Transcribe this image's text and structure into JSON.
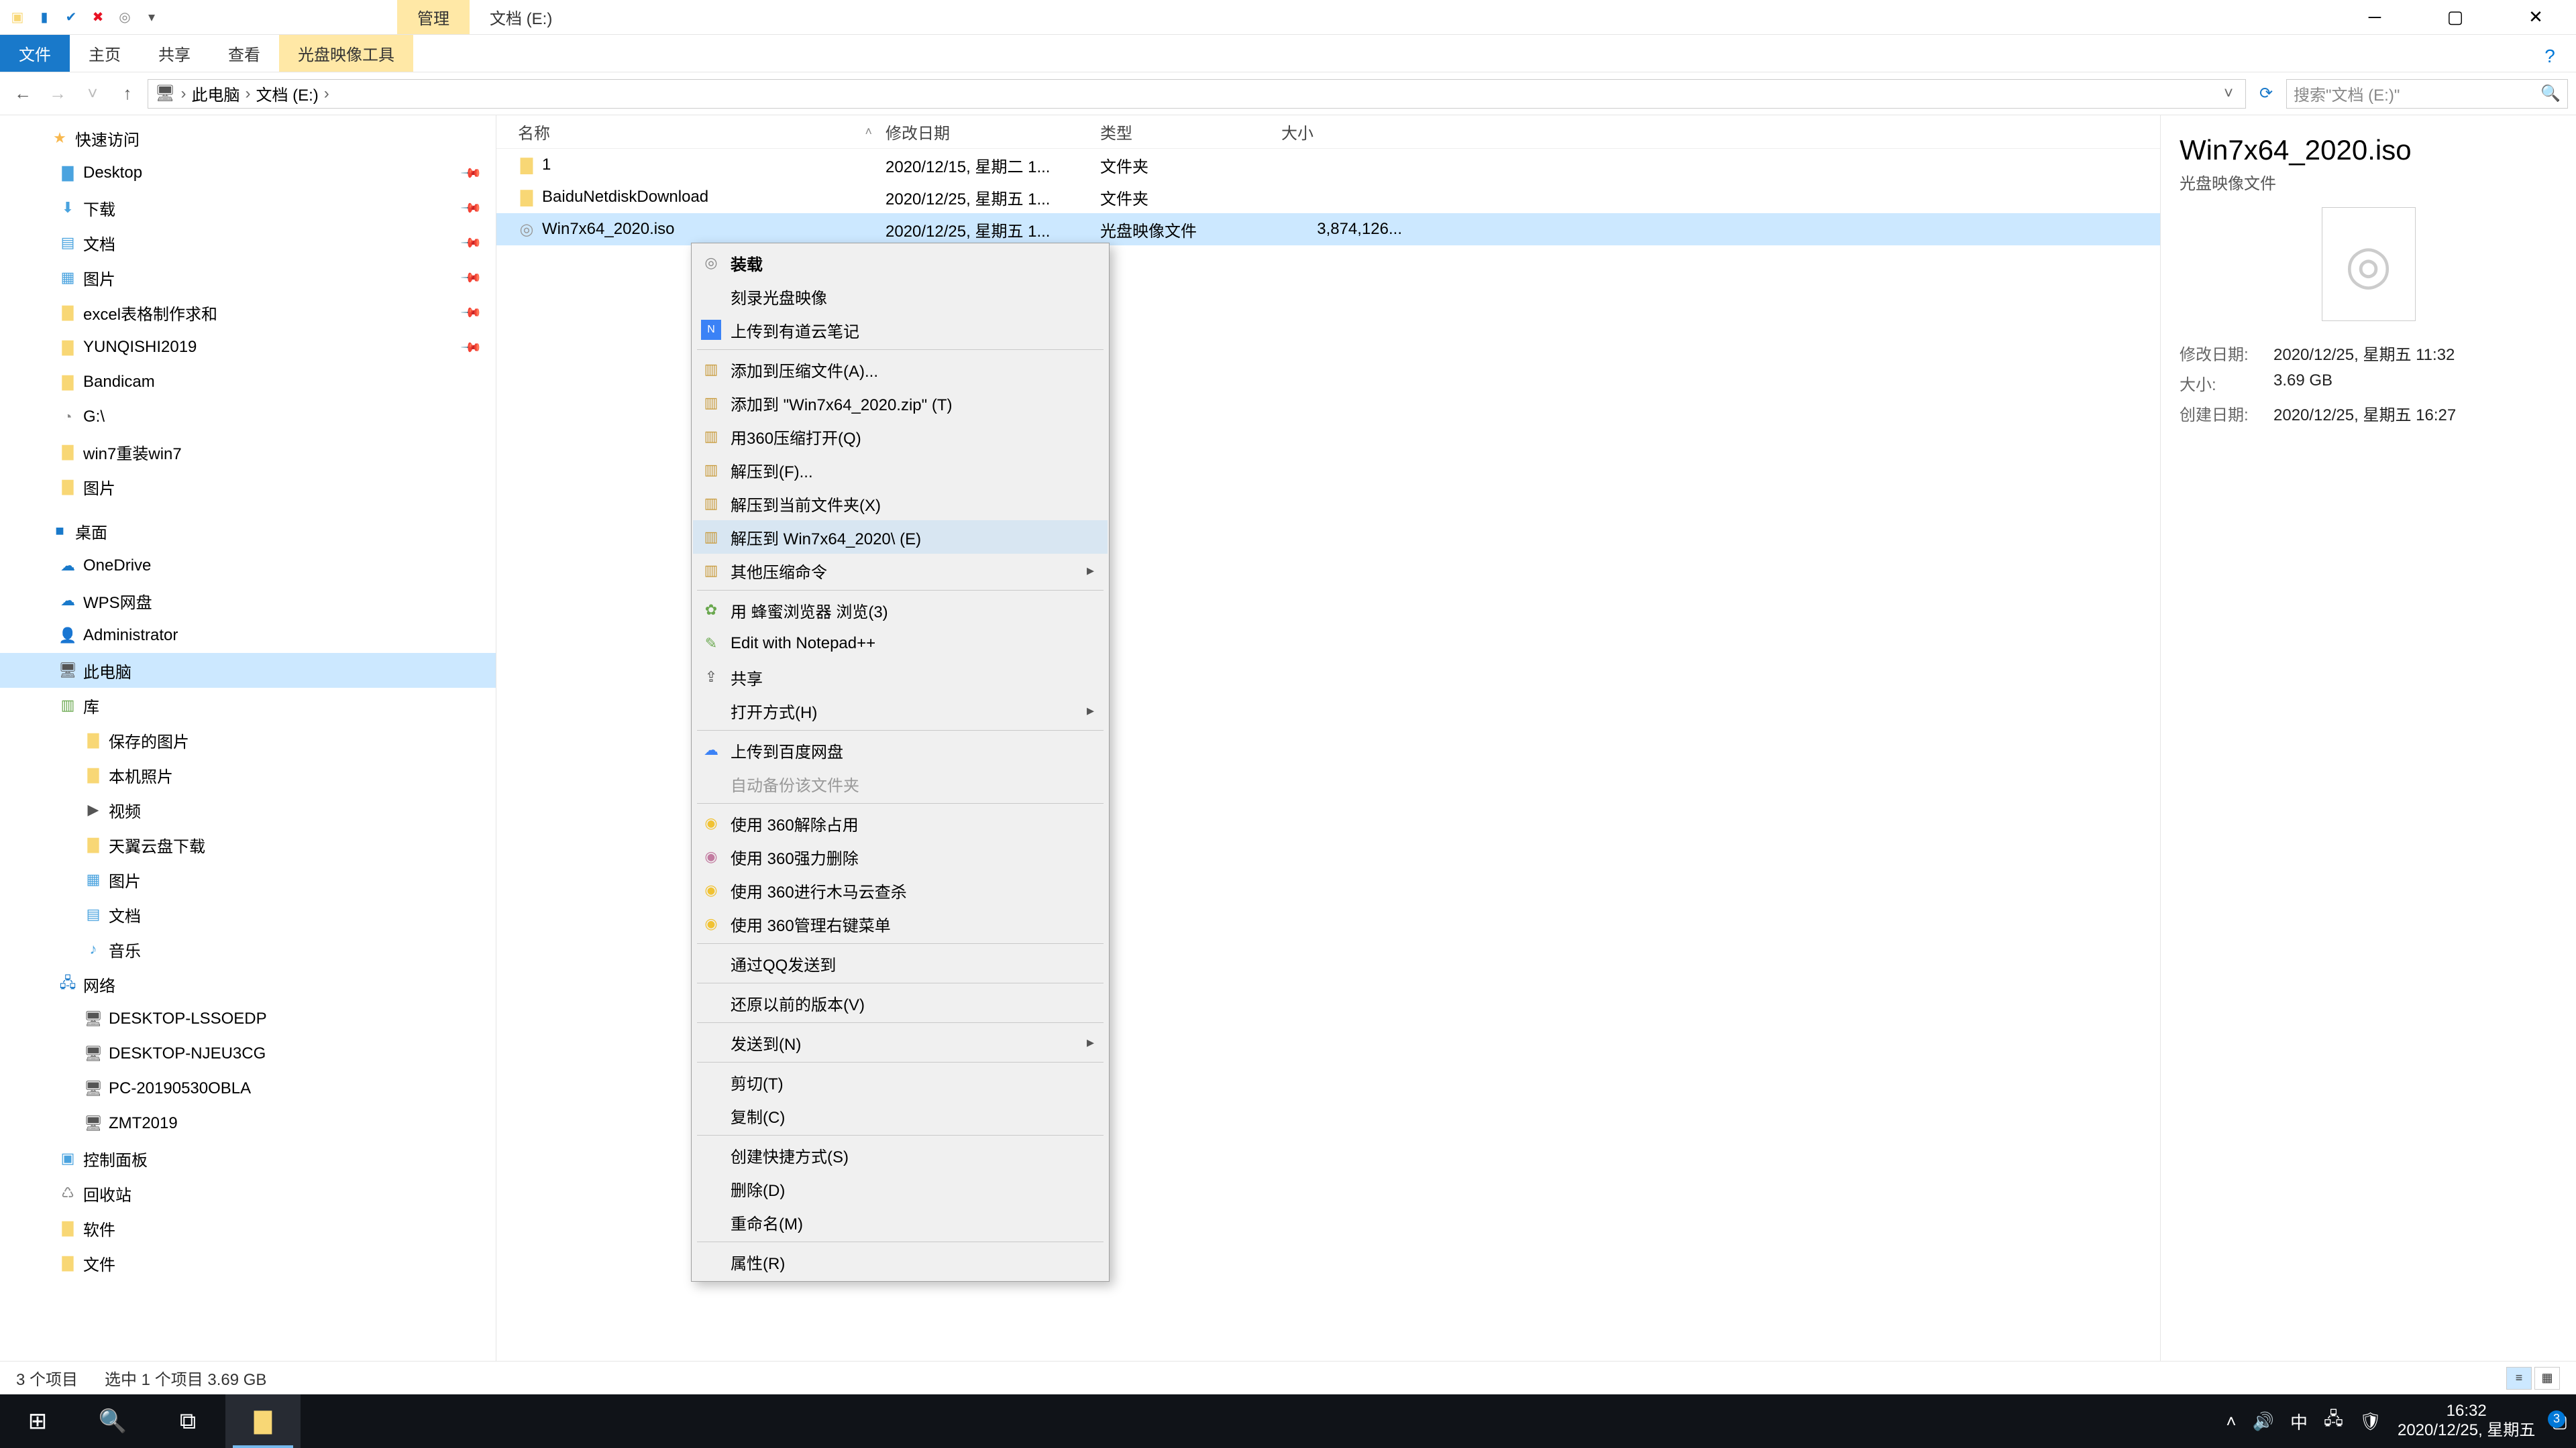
{
  "titlebar": {
    "context_tab": "管理",
    "window_title": "文档 (E:)"
  },
  "ribbon": {
    "file": "文件",
    "home": "主页",
    "share": "共享",
    "view": "查看",
    "ctx": "光盘映像工具"
  },
  "nav": {
    "crumbs": [
      "此电脑",
      "文档 (E:)"
    ],
    "search_placeholder": "搜索\"文档 (E:)\""
  },
  "columns": {
    "name": "名称",
    "modified": "修改日期",
    "type": "类型",
    "size": "大小"
  },
  "tree": {
    "quick": "快速访问",
    "quick_items": [
      "Desktop",
      "下载",
      "文档",
      "图片",
      "excel表格制作求和",
      "YUNQISHI2019",
      "Bandicam",
      "G:\\",
      "win7重装win7",
      "图片"
    ],
    "desktop": "桌面",
    "desktop_items": [
      "OneDrive",
      "WPS网盘",
      "Administrator",
      "此电脑",
      "库",
      "保存的图片",
      "本机照片",
      "视频",
      "天翼云盘下载",
      "图片",
      "文档",
      "音乐",
      "网络",
      "DESKTOP-LSSOEDP",
      "DESKTOP-NJEU3CG",
      "PC-20190530OBLA",
      "ZMT2019",
      "控制面板",
      "回收站",
      "软件",
      "文件"
    ]
  },
  "files": [
    {
      "name": "1",
      "mod": "2020/12/15, 星期二 1...",
      "type": "文件夹",
      "size": ""
    },
    {
      "name": "BaiduNetdiskDownload",
      "mod": "2020/12/25, 星期五 1...",
      "type": "文件夹",
      "size": ""
    },
    {
      "name": "Win7x64_2020.iso",
      "mod": "2020/12/25, 星期五 1...",
      "type": "光盘映像文件",
      "size": "3,874,126..."
    }
  ],
  "contextmenu": {
    "mount": "装载",
    "burn": "刻录光盘映像",
    "youdao": "上传到有道云笔记",
    "add_archive": "添加到压缩文件(A)...",
    "add_zip": "添加到 \"Win7x64_2020.zip\" (T)",
    "open_360zip": "用360压缩打开(Q)",
    "extract_to": "解压到(F)...",
    "extract_here": "解压到当前文件夹(X)",
    "extract_named": "解压到 Win7x64_2020\\ (E)",
    "other_zip": "其他压缩命令",
    "honey": "用 蜂蜜浏览器 浏览(3)",
    "npp": "Edit with Notepad++",
    "share": "共享",
    "openwith": "打开方式(H)",
    "baidu": "上传到百度网盘",
    "autobackup": "自动备份该文件夹",
    "p360_unlock": "使用 360解除占用",
    "p360_delete": "使用 360强力删除",
    "p360_scan": "使用 360进行木马云查杀",
    "p360_ctx": "使用 360管理右键菜单",
    "qq": "通过QQ发送到",
    "restore": "还原以前的版本(V)",
    "sendto": "发送到(N)",
    "cut": "剪切(T)",
    "copy": "复制(C)",
    "shortcut": "创建快捷方式(S)",
    "delete": "删除(D)",
    "rename": "重命名(M)",
    "props": "属性(R)"
  },
  "details": {
    "fname": "Win7x64_2020.iso",
    "ftype": "光盘映像文件",
    "mod_label": "修改日期:",
    "mod_val": "2020/12/25, 星期五 11:32",
    "size_label": "大小:",
    "size_val": "3.69 GB",
    "create_label": "创建日期:",
    "create_val": "2020/12/25, 星期五 16:27"
  },
  "status": {
    "count": "3 个项目",
    "sel": "选中 1 个项目  3.69 GB"
  },
  "clock": {
    "time": "16:32",
    "date": "2020/12/25, 星期五"
  },
  "ime": "中"
}
